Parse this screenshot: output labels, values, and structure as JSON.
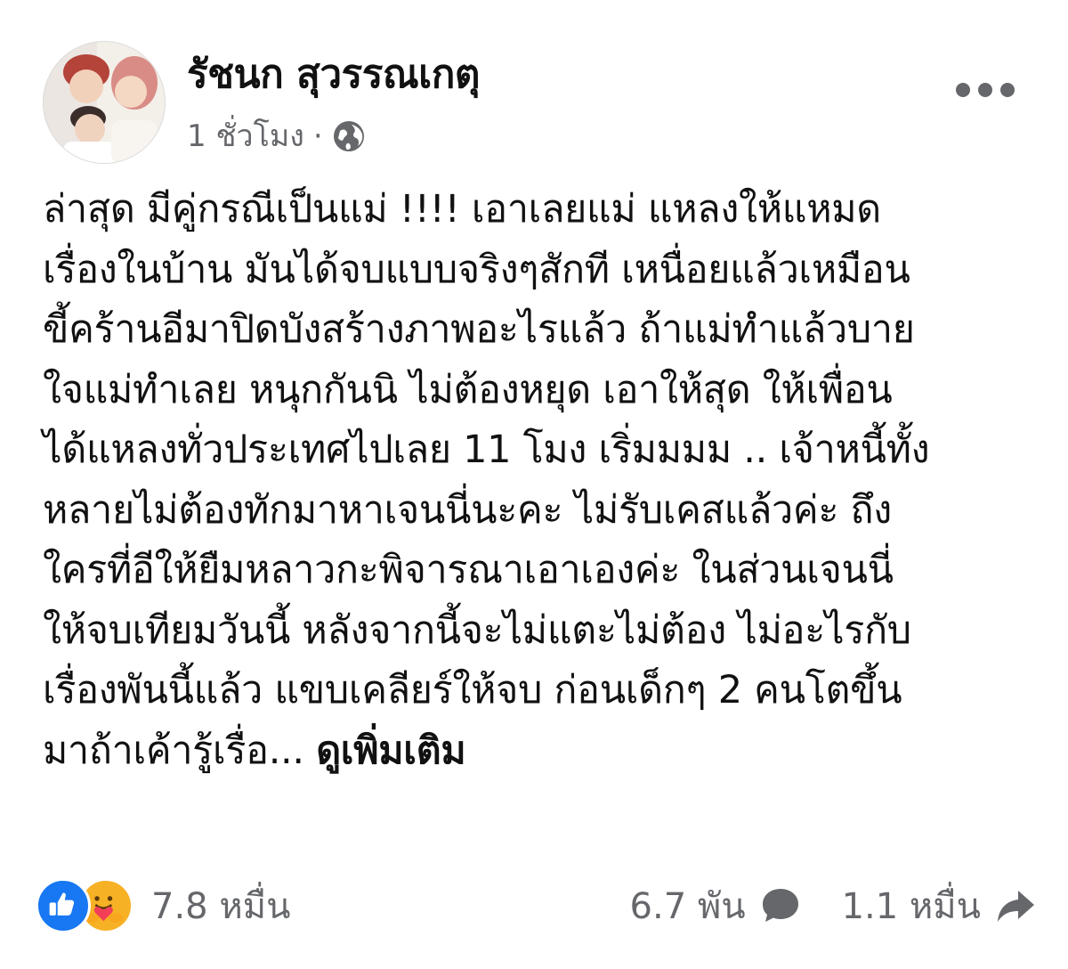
{
  "post": {
    "author": "รัชนก สุวรรณเกตุ",
    "time": "1 ชั่วโมง",
    "separator": "·",
    "privacy_icon": "globe-icon",
    "more_icon": "more-options-icon",
    "body_lines": [
      "ล่าสุด มีคู่กรณีเป็นแม่ !!!! เอาเลยแม่ แหลงให้แหมด",
      "เรื่องในบ้าน มันได้จบแบบจริงๆสักที เหนื่อยแล้วเหมือน",
      "ขี้คร้านอีมาปิดบังสร้างภาพอะไรแล้ว ถ้าแม่ทำแล้วบาย",
      "ใจแม่ทำเลย หนุกกันนิ ไม่ต้องหยุด เอาให้สุด ให้เพื่อน",
      "ได้แหลงทั่วประเทศไปเลย 11 โมง เริ่มมมม .. เจ้าหนี้ทั้ง",
      "หลายไม่ต้องทักมาหาเจนนี่นะคะ ไม่รับเคสแล้วค่ะ ถึง",
      "ใครที่อีให้ยืมหลาวกะพิจารณาเอาเองค่ะ ในส่วนเจนนี่",
      "ให้จบเทียมวันนี้ หลังจากนี้จะไม่แตะไม่ต้อง ไม่อะไรกับ",
      "เรื่องพันนี้แล้ว แขบเคลียร์ให้จบ ก่อนเด็กๆ 2 คนโตขึ้น"
    ],
    "body_last_line": "มาถ้าเค้ารู้เรื่อ...",
    "see_more": "ดูเพิ่มเติม"
  },
  "footer": {
    "reaction_icons": [
      "like-icon",
      "care-icon"
    ],
    "reaction_count": "7.8 หมื่น",
    "comments_count": "6.7 พัน",
    "comment_icon": "comment-icon",
    "shares_count": "1.1 หมื่น",
    "share_icon": "share-icon"
  },
  "colors": {
    "text": "#050505",
    "secondary": "#65676b",
    "like_blue": "#1877f2",
    "care_yellow": "#f7b125"
  }
}
